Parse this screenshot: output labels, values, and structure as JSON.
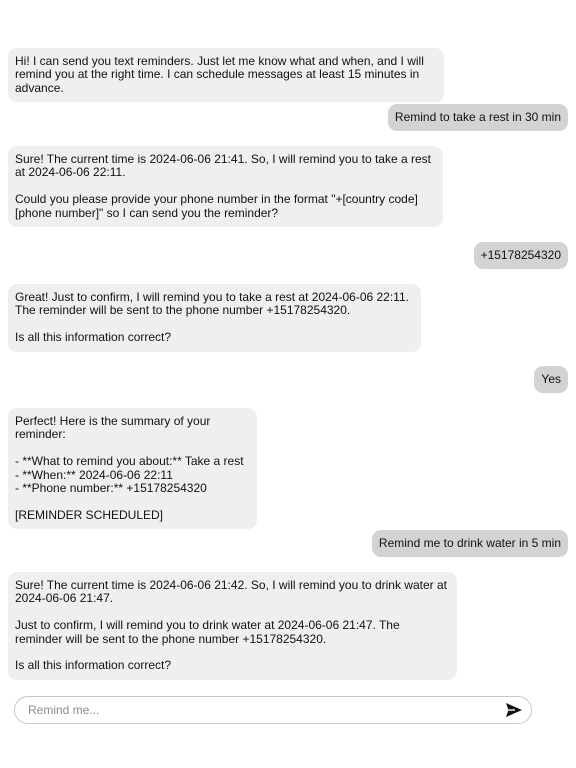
{
  "chat": {
    "messages": [
      {
        "role": "bot",
        "text": "Hi! I can send you text reminders. Just let me know what and when, and I will remind you at the right time. I can schedule messages at least 15 minutes in advance."
      },
      {
        "role": "user",
        "text": "Remind to take a rest in 30 min"
      },
      {
        "role": "bot",
        "text": "Sure! The current time is 2024-06-06 21:41. So, I will remind you to take a rest at 2024-06-06 22:11.\n\nCould you please provide your phone number in the format \"+[country code][phone number]\" so I can send you the reminder?"
      },
      {
        "role": "user",
        "text": "+15178254320"
      },
      {
        "role": "bot",
        "text": "Great! Just to confirm, I will remind you to take a rest at 2024-06-06 22:11. The reminder will be sent to the phone number +15178254320.\n\nIs all this information correct?"
      },
      {
        "role": "user",
        "text": "Yes"
      },
      {
        "role": "bot",
        "text": "Perfect! Here is the summary of your reminder:\n\n- **What to remind you about:** Take a rest\n- **When:** 2024-06-06 22:11\n- **Phone number:** +15178254320\n\n[REMINDER SCHEDULED]"
      },
      {
        "role": "user",
        "text": "Remind me to drink water in 5 min"
      },
      {
        "role": "bot",
        "text": "Sure! The current time is 2024-06-06 21:42. So, I will remind you to drink water at 2024-06-06 21:47.\n\nJust to confirm, I will remind you to drink water at 2024-06-06 21:47. The reminder will be sent to the phone number +15178254320.\n\nIs all this information correct?"
      }
    ]
  },
  "composer": {
    "placeholder": "Remind me...",
    "value": "",
    "send_icon": "send-icon"
  },
  "colors": {
    "bot_bubble": "#efefef",
    "user_bubble": "#d3d3d3",
    "send_icon": "#111111"
  }
}
